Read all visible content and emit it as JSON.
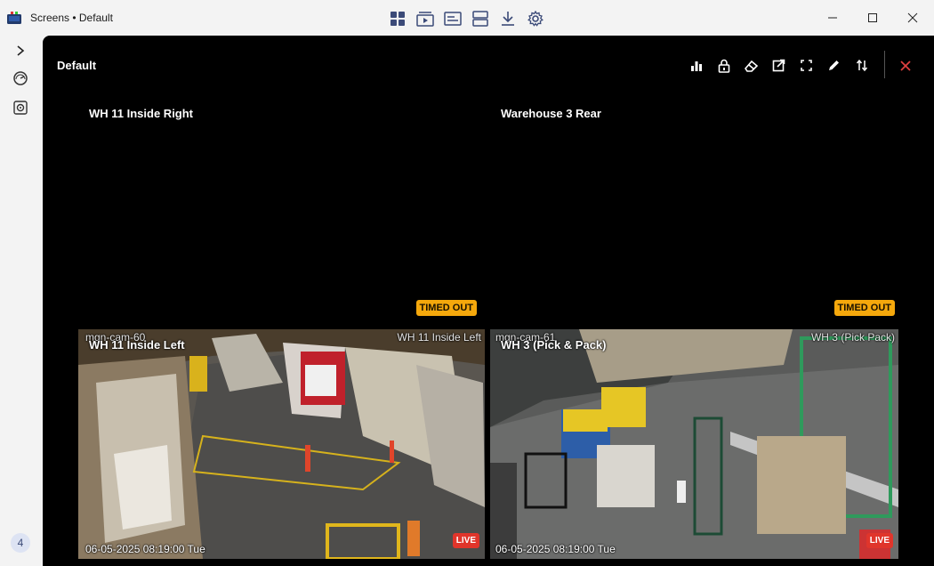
{
  "window": {
    "title": "Screens • Default",
    "toolbar_icons": [
      "grid-icon",
      "playback-icon",
      "view-icon",
      "layout-icon",
      "download-icon",
      "gear-icon"
    ]
  },
  "sidebar": {
    "items": [
      "expand-chevron-icon",
      "gauge-icon",
      "camera-settings-icon"
    ],
    "badge": "4"
  },
  "screen": {
    "title": "Default",
    "tools": [
      "stats-icon",
      "lock-icon",
      "eraser-icon",
      "open-external-icon",
      "fullscreen-icon",
      "edit-icon",
      "swap-icon"
    ]
  },
  "tiles": [
    {
      "name": "WH 11 Inside Right",
      "status": "TIMED OUT"
    },
    {
      "name": "Warehouse 3 Rear",
      "status": "TIMED OUT"
    },
    {
      "name": "WH 11 Inside Left",
      "camera_id": "mgn-cam-60",
      "camera_label": "WH 11 Inside Left",
      "timestamp": "06-05-2025 08:19:00 Tue",
      "status": "LIVE"
    },
    {
      "name": "WH 3 (Pick & Pack)",
      "camera_id": "mgn-cam-61",
      "camera_label": "WH 3 (Pick  Pack)",
      "timestamp": "06-05-2025 08:19:00 Tue",
      "status": "LIVE"
    }
  ],
  "colors": {
    "accent": "#3b4a78",
    "timed_out": "#f5a80c",
    "live": "#e0352b",
    "close": "#e04040"
  }
}
